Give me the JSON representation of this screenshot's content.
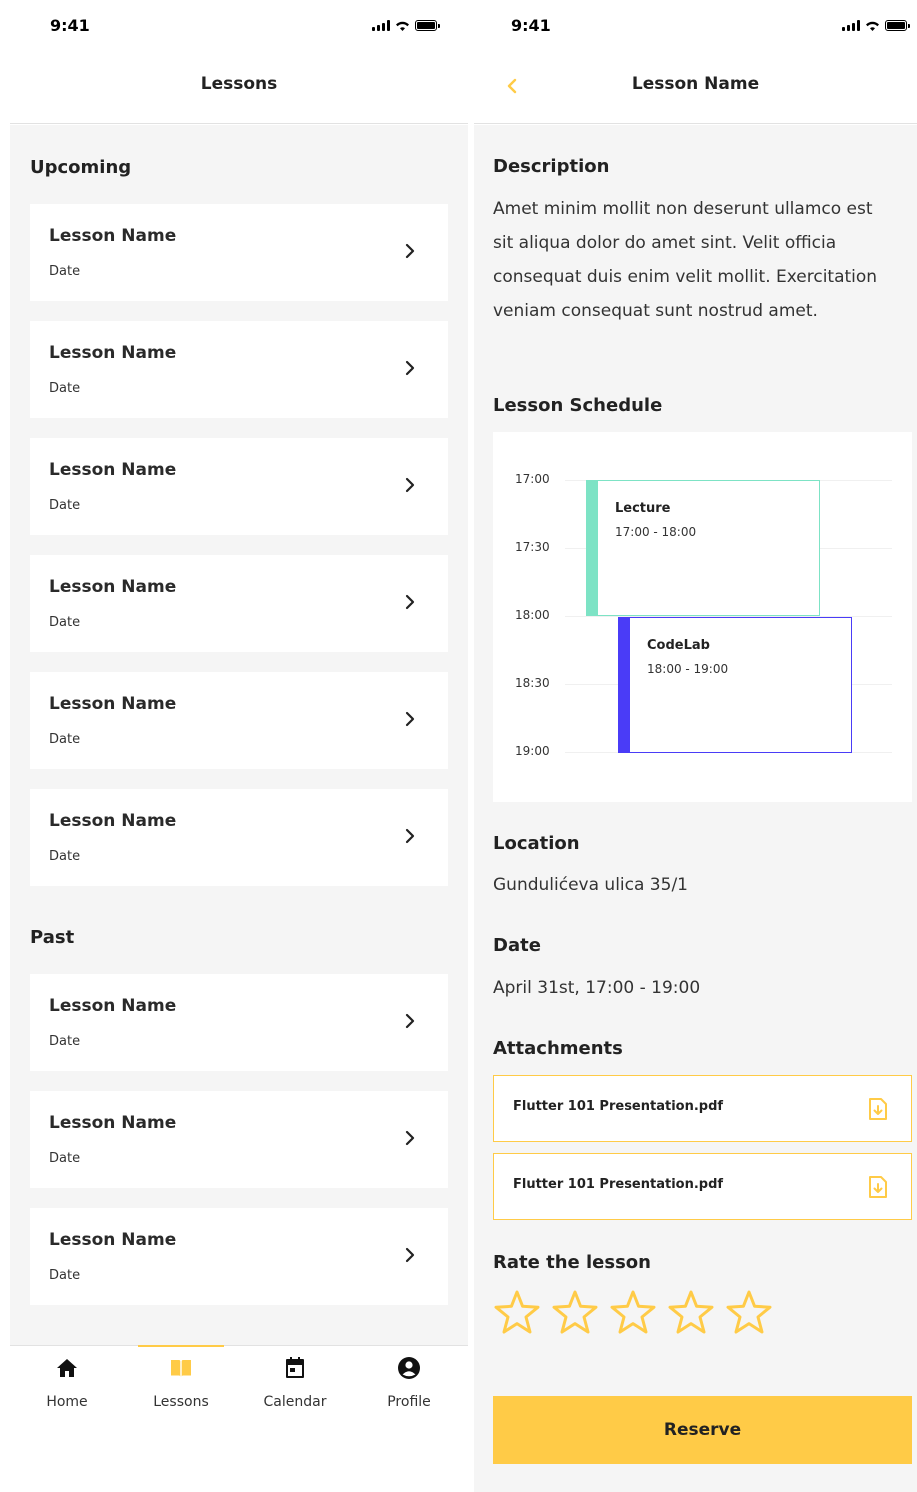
{
  "colors": {
    "accent": "#ffcb47",
    "background": "#f5f5f5",
    "lecture": "#7de3c5",
    "codelab": "#4a3cf7"
  },
  "lessons_screen": {
    "status": {
      "time": "9:41"
    },
    "title": "Lessons",
    "upcoming_title": "Upcoming",
    "upcoming": [
      {
        "name": "Lesson Name",
        "date": "Date"
      },
      {
        "name": "Lesson Name",
        "date": "Date"
      },
      {
        "name": "Lesson Name",
        "date": "Date"
      },
      {
        "name": "Lesson Name",
        "date": "Date"
      },
      {
        "name": "Lesson Name",
        "date": "Date"
      },
      {
        "name": "Lesson Name",
        "date": "Date"
      }
    ],
    "past_title": "Past",
    "past": [
      {
        "name": "Lesson Name",
        "date": "Date"
      },
      {
        "name": "Lesson Name",
        "date": "Date"
      },
      {
        "name": "Lesson Name",
        "date": "Date"
      }
    ],
    "tabs": [
      {
        "label": "Home",
        "icon": "home-icon",
        "active": false
      },
      {
        "label": "Lessons",
        "icon": "book-icon",
        "active": true
      },
      {
        "label": "Calendar",
        "icon": "calendar-icon",
        "active": false
      },
      {
        "label": "Profile",
        "icon": "profile-icon",
        "active": false
      }
    ]
  },
  "detail_screen": {
    "status": {
      "time": "9:41"
    },
    "title": "Lesson Name",
    "description_title": "Description",
    "description": "Amet minim mollit non deserunt ullamco est sit aliqua dolor do amet sint. Velit officia consequat duis enim velit mollit. Exercitation veniam consequat sunt nostrud amet.",
    "schedule_title": "Lesson Schedule",
    "schedule": {
      "times": [
        "17:00",
        "17:30",
        "18:00",
        "18:30",
        "19:00"
      ],
      "events": [
        {
          "title": "Lecture",
          "time": "17:00 - 18:00"
        },
        {
          "title": "CodeLab",
          "time": "18:00 - 19:00"
        }
      ]
    },
    "location_title": "Location",
    "location": "Gundulićeva ulica 35/1",
    "date_title": "Date",
    "date": "April 31st, 17:00 - 19:00",
    "attachments_title": "Attachments",
    "attachments": [
      {
        "name": "Flutter 101 Presentation.pdf"
      },
      {
        "name": "Flutter 101 Presentation.pdf"
      }
    ],
    "rate_title": "Rate the lesson",
    "rating": {
      "value": 0,
      "max": 5
    },
    "reserve_label": "Reserve"
  }
}
